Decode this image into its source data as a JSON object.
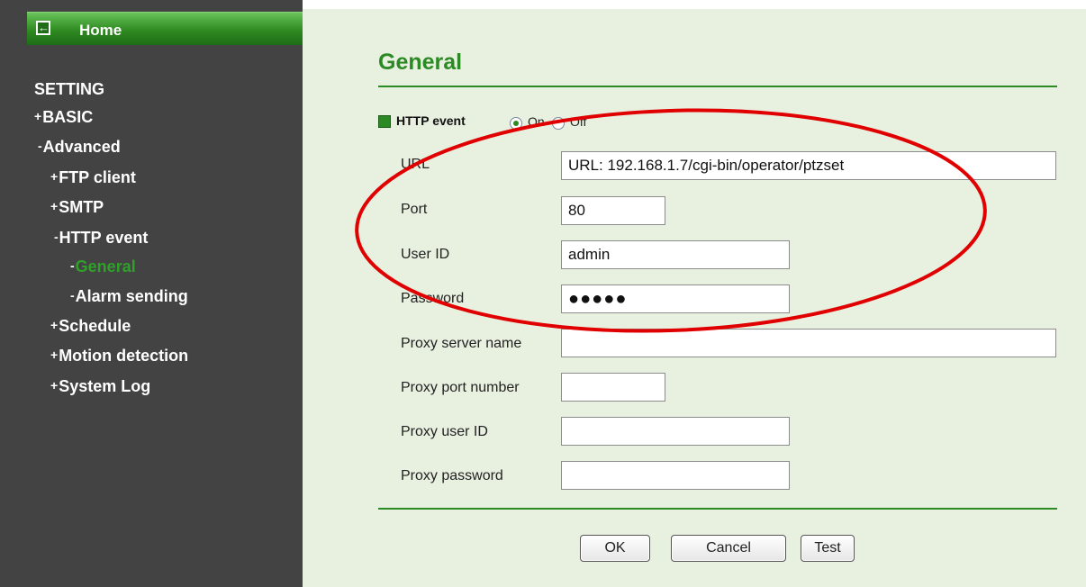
{
  "sidebar": {
    "home_label": "Home",
    "items": [
      {
        "prefix": "",
        "label": "SETTING"
      },
      {
        "prefix": "+",
        "label": "BASIC"
      },
      {
        "prefix": "-",
        "label": "Advanced"
      },
      {
        "prefix": "+",
        "label": "FTP client"
      },
      {
        "prefix": "+",
        "label": "SMTP"
      },
      {
        "prefix": "-",
        "label": "HTTP event"
      },
      {
        "prefix": "-",
        "label": "General"
      },
      {
        "prefix": "-",
        "label": "Alarm sending"
      },
      {
        "prefix": "+",
        "label": "Schedule"
      },
      {
        "prefix": "+",
        "label": "Motion detection"
      },
      {
        "prefix": "+",
        "label": "System Log"
      }
    ]
  },
  "main": {
    "title": "General",
    "http_event": {
      "label": "HTTP event",
      "on_label": "On",
      "off_label": "Off",
      "selected": "On"
    },
    "fields": [
      {
        "label": "URL",
        "value": "URL: 192.168.1.7/cgi-bin/operator/ptzset"
      },
      {
        "label": "Port",
        "value": "80"
      },
      {
        "label": "User ID",
        "value": "admin"
      },
      {
        "label": "Password",
        "value": "●●●●●"
      },
      {
        "label": "Proxy server name",
        "value": ""
      },
      {
        "label": "Proxy port number",
        "value": ""
      },
      {
        "label": "Proxy user ID",
        "value": ""
      },
      {
        "label": "Proxy password",
        "value": ""
      }
    ],
    "buttons": {
      "ok": "OK",
      "cancel": "Cancel",
      "test": "Test"
    }
  },
  "colors": {
    "sidebar_bg": "#434343",
    "accent_green": "#2b8a24",
    "content_bg": "#e8f0e0",
    "annotation_red": "#e00000"
  }
}
